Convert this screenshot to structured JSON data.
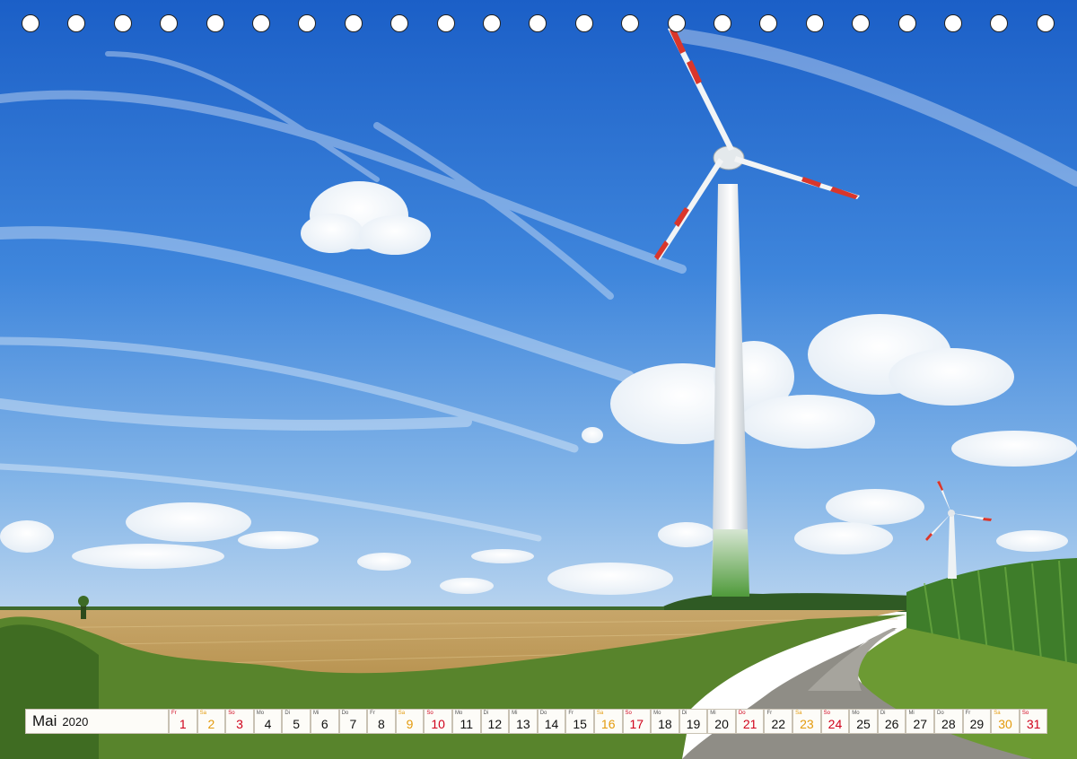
{
  "calendar": {
    "month": "Mai",
    "year": "2020",
    "days": [
      {
        "abbr": "Fr",
        "num": "1",
        "type": "holiday"
      },
      {
        "abbr": "Sa",
        "num": "2",
        "type": "sat"
      },
      {
        "abbr": "So",
        "num": "3",
        "type": "sun"
      },
      {
        "abbr": "Mo",
        "num": "4",
        "type": "weekday"
      },
      {
        "abbr": "Di",
        "num": "5",
        "type": "weekday"
      },
      {
        "abbr": "Mi",
        "num": "6",
        "type": "weekday"
      },
      {
        "abbr": "Do",
        "num": "7",
        "type": "weekday"
      },
      {
        "abbr": "Fr",
        "num": "8",
        "type": "weekday"
      },
      {
        "abbr": "Sa",
        "num": "9",
        "type": "sat"
      },
      {
        "abbr": "So",
        "num": "10",
        "type": "sun"
      },
      {
        "abbr": "Mo",
        "num": "11",
        "type": "weekday"
      },
      {
        "abbr": "Di",
        "num": "12",
        "type": "weekday"
      },
      {
        "abbr": "Mi",
        "num": "13",
        "type": "weekday"
      },
      {
        "abbr": "Do",
        "num": "14",
        "type": "weekday"
      },
      {
        "abbr": "Fr",
        "num": "15",
        "type": "weekday"
      },
      {
        "abbr": "Sa",
        "num": "16",
        "type": "sat"
      },
      {
        "abbr": "So",
        "num": "17",
        "type": "sun"
      },
      {
        "abbr": "Mo",
        "num": "18",
        "type": "weekday"
      },
      {
        "abbr": "Di",
        "num": "19",
        "type": "weekday"
      },
      {
        "abbr": "Mi",
        "num": "20",
        "type": "weekday"
      },
      {
        "abbr": "Do",
        "num": "21",
        "type": "holiday"
      },
      {
        "abbr": "Fr",
        "num": "22",
        "type": "weekday"
      },
      {
        "abbr": "Sa",
        "num": "23",
        "type": "sat"
      },
      {
        "abbr": "So",
        "num": "24",
        "type": "sun"
      },
      {
        "abbr": "Mo",
        "num": "25",
        "type": "weekday"
      },
      {
        "abbr": "Di",
        "num": "26",
        "type": "weekday"
      },
      {
        "abbr": "Mi",
        "num": "27",
        "type": "weekday"
      },
      {
        "abbr": "Do",
        "num": "28",
        "type": "weekday"
      },
      {
        "abbr": "Fr",
        "num": "29",
        "type": "weekday"
      },
      {
        "abbr": "Sa",
        "num": "30",
        "type": "sat"
      },
      {
        "abbr": "So",
        "num": "31",
        "type": "sun"
      }
    ]
  },
  "colors": {
    "sunday": "#d0021b",
    "holiday": "#d0021b",
    "saturday": "#e39a0c",
    "weekday": "#111111",
    "sky_top": "#1f63c9",
    "sky_bottom": "#9dc3ea",
    "wheat": "#c9a55c",
    "grass": "#5f8f2e"
  },
  "binding_holes": 23
}
